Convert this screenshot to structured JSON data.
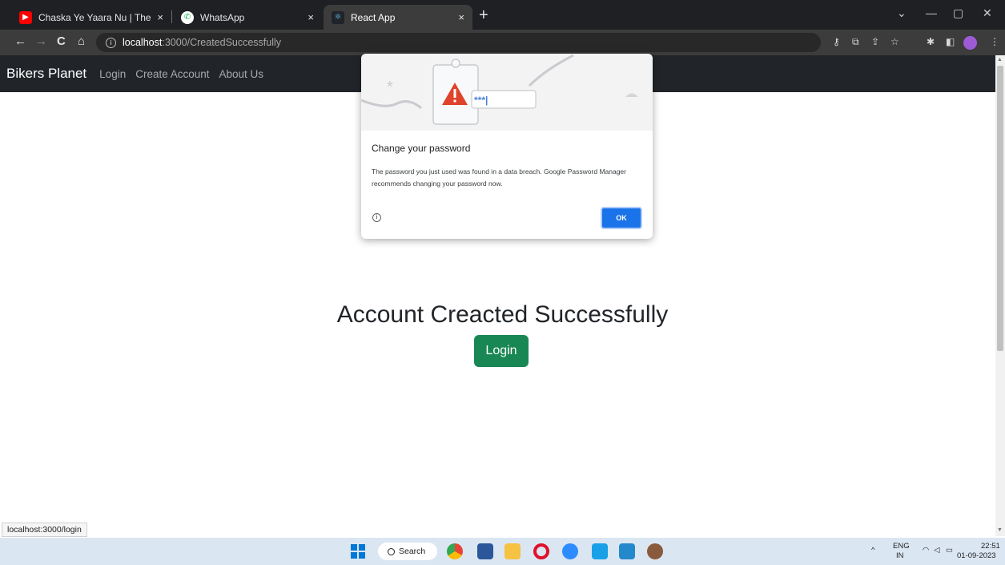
{
  "browser": {
    "tabs": [
      {
        "title": "Chaska Ye Yaara Nu | The Crown",
        "close": "×"
      },
      {
        "title": "WhatsApp",
        "close": "×"
      },
      {
        "title": "React App",
        "close": "×"
      }
    ],
    "new_tab": "+",
    "url_host": "localhost",
    "url_path": ":3000/CreatedSuccessfully",
    "nav": {
      "back": "←",
      "forward": "→",
      "reload": "C",
      "home": "⌂"
    },
    "window": {
      "chevron": "⌄",
      "minimize": "—",
      "restore": "▢",
      "close": "✕"
    }
  },
  "app": {
    "brand": "Bikers Planet",
    "nav_links": [
      "Login",
      "Create Account",
      "About Us"
    ],
    "headline": "Account Creacted Successfully",
    "login_button": "Login"
  },
  "dialog": {
    "illustration_text": "***|",
    "title": "Change your password",
    "body": "The password you just used was found in a data breach. Google Password Manager recommends changing your password now.",
    "info": "i",
    "ok_label": "OK"
  },
  "status_tooltip": "localhost:3000/login",
  "taskbar": {
    "search_label": "Search",
    "lang_top": "ENG",
    "lang_bottom": "IN",
    "time": "22:51",
    "date": "01-09-2023"
  },
  "colors": {
    "navbar": "#212529",
    "login_button": "#198754",
    "ok_button": "#1a73e8"
  }
}
